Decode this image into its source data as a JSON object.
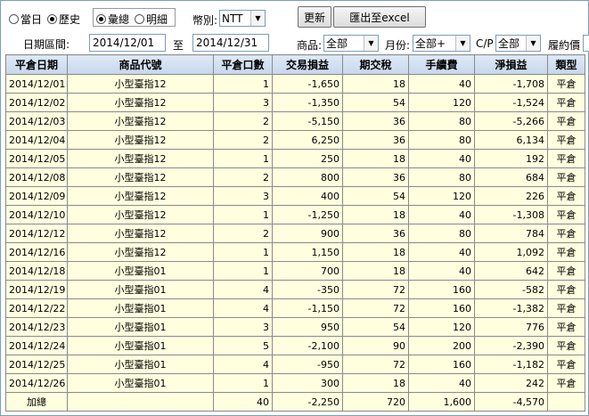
{
  "filters": {
    "mode_options": [
      "當日",
      "歷史"
    ],
    "mode_selected": 1,
    "view_options": [
      "彙總",
      "明細"
    ],
    "view_selected": 0,
    "currency_label": "幣別:",
    "currency_value": "NTT",
    "refresh_button": "更新",
    "export_button": "匯出至excel",
    "date_range_label": "日期區間:",
    "date_from": "2014/12/01",
    "date_to_label": "至",
    "date_to": "2014/12/31",
    "product_label": "商品:",
    "product_value": "全部",
    "month_label": "月份:",
    "month_value": "全部+",
    "cp_label": "C/P",
    "cp_value": "全部",
    "strike_label": "履約價"
  },
  "table": {
    "headers": [
      "平倉日期",
      "商品代號",
      "平倉口數",
      "交易損益",
      "期交稅",
      "手續費",
      "淨損益",
      "類型"
    ],
    "rows": [
      [
        "2014/12/01",
        "小型臺指12",
        "1",
        "-1,650",
        "18",
        "40",
        "-1,708",
        "平倉"
      ],
      [
        "2014/12/02",
        "小型臺指12",
        "3",
        "-1,350",
        "54",
        "120",
        "-1,524",
        "平倉"
      ],
      [
        "2014/12/03",
        "小型臺指12",
        "2",
        "-5,150",
        "36",
        "80",
        "-5,266",
        "平倉"
      ],
      [
        "2014/12/04",
        "小型臺指12",
        "2",
        "6,250",
        "36",
        "80",
        "6,134",
        "平倉"
      ],
      [
        "2014/12/05",
        "小型臺指12",
        "1",
        "250",
        "18",
        "40",
        "192",
        "平倉"
      ],
      [
        "2014/12/08",
        "小型臺指12",
        "2",
        "800",
        "36",
        "80",
        "684",
        "平倉"
      ],
      [
        "2014/12/09",
        "小型臺指12",
        "3",
        "400",
        "54",
        "120",
        "226",
        "平倉"
      ],
      [
        "2014/12/10",
        "小型臺指12",
        "1",
        "-1,250",
        "18",
        "40",
        "-1,308",
        "平倉"
      ],
      [
        "2014/12/12",
        "小型臺指12",
        "2",
        "900",
        "36",
        "80",
        "784",
        "平倉"
      ],
      [
        "2014/12/16",
        "小型臺指12",
        "1",
        "1,150",
        "18",
        "40",
        "1,092",
        "平倉"
      ],
      [
        "2014/12/18",
        "小型臺指01",
        "1",
        "700",
        "18",
        "40",
        "642",
        "平倉"
      ],
      [
        "2014/12/19",
        "小型臺指01",
        "4",
        "-350",
        "72",
        "160",
        "-582",
        "平倉"
      ],
      [
        "2014/12/22",
        "小型臺指01",
        "4",
        "-1,150",
        "72",
        "160",
        "-1,382",
        "平倉"
      ],
      [
        "2014/12/23",
        "小型臺指01",
        "3",
        "950",
        "54",
        "120",
        "776",
        "平倉"
      ],
      [
        "2014/12/24",
        "小型臺指01",
        "5",
        "-2,100",
        "90",
        "200",
        "-2,390",
        "平倉"
      ],
      [
        "2014/12/25",
        "小型臺指01",
        "4",
        "-950",
        "72",
        "160",
        "-1,182",
        "平倉"
      ],
      [
        "2014/12/26",
        "小型臺指01",
        "1",
        "300",
        "18",
        "40",
        "242",
        "平倉"
      ]
    ],
    "total": [
      "加總",
      "",
      "40",
      "-2,250",
      "720",
      "1,600",
      "-4,570",
      ""
    ]
  }
}
